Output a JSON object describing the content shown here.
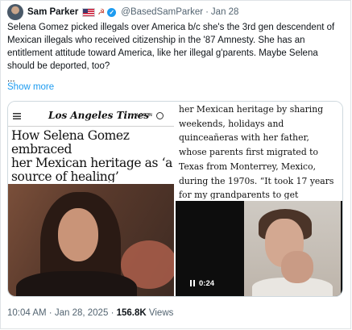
{
  "tweet": {
    "author_name": "Sam Parker",
    "handle": "@BasedSamParker",
    "separator": "·",
    "date": "Jan 28",
    "text_lines": [
      "Selena Gomez picked illegals over America b/c she's the 3rd gen descendent of",
      "Mexican illegals who received citizenship in the '87 Amnesty. She has an",
      "entitlement attitude toward America, like her illegal g'parents. Maybe Selena",
      "should be deported, too?",
      "..."
    ],
    "show_more": "Show more",
    "icons": {
      "flag": "us-flag-icon",
      "badge": "hammer-sickle-icon",
      "verified": "verified-check-icon"
    }
  },
  "media": {
    "lat": {
      "logo": "Los Angeles Times",
      "login": "LOG IN",
      "headline_lines": [
        "How Selena Gomez embraced",
        "her Mexican heritage as ‘a",
        "source of healing’"
      ]
    },
    "article_lines": [
      "her Mexican heritage by sharing",
      "weekends, holidays and",
      "quinceañeras with her father,",
      "whose parents first migrated to",
      "Texas from Monterrey, Mexico,",
      "during the 1970s. “It took 17 years",
      "for my grandparents to get"
    ],
    "video": {
      "timestamp": "0:24"
    }
  },
  "footer": {
    "time": "10:04 AM",
    "separator": "·",
    "date": "Jan 28, 2025",
    "views_count": "156.8K",
    "views_label": "Views"
  },
  "colors": {
    "link": "#1d9bf0",
    "muted": "#536471",
    "text": "#0f1419"
  }
}
